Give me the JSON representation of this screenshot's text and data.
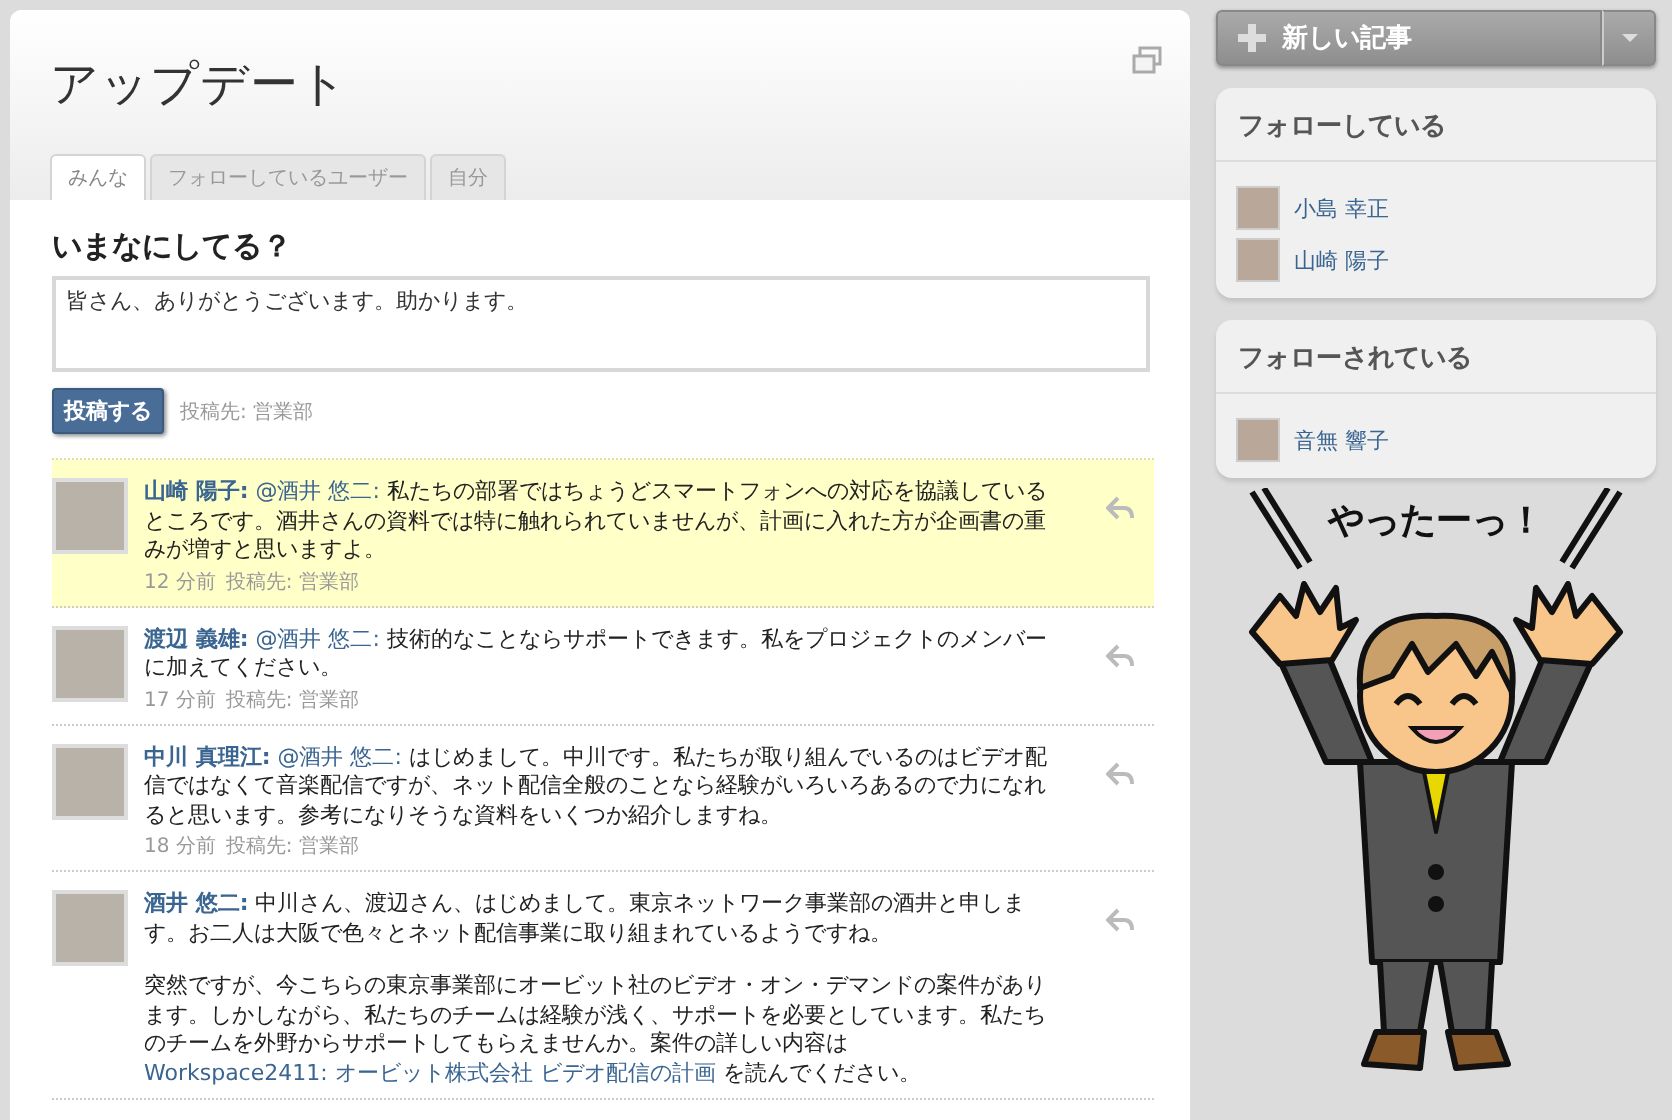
{
  "header": {
    "title": "アップデート"
  },
  "tabs": [
    {
      "label": "みんな",
      "selected": true
    },
    {
      "label": "フォローしているユーザー",
      "selected": false
    },
    {
      "label": "自分",
      "selected": false
    }
  ],
  "composer": {
    "heading": "いまなにしてる？",
    "value": "皆さん、ありがとうございます。助かります。",
    "button": "投稿する",
    "target": "投稿先: 営業部"
  },
  "posts": [
    {
      "author": "山崎 陽子:",
      "mention": "@酒井 悠二:",
      "highlighted": true,
      "paragraphs": [
        [
          {
            "kind": "text",
            "text": "私たちの部署ではちょうどスマートフォンへの対応を協議しているところです。酒井さんの資料では特に触れられていませんが、計画に入れた方が企画書の重みが増すと思いますよ。"
          }
        ]
      ],
      "time": "12 分前",
      "target": "投稿先: 営業部"
    },
    {
      "author": "渡辺 義雄:",
      "mention": "@酒井 悠二:",
      "highlighted": false,
      "paragraphs": [
        [
          {
            "kind": "text",
            "text": "技術的なことならサポートできます。私をプロジェクトのメンバーに加えてください。"
          }
        ]
      ],
      "time": "17 分前",
      "target": "投稿先: 営業部"
    },
    {
      "author": "中川 真理江:",
      "mention": "@酒井 悠二:",
      "highlighted": false,
      "paragraphs": [
        [
          {
            "kind": "text",
            "text": "はじめまして。中川です。私たちが取り組んでいるのはビデオ配信ではなくて音楽配信ですが、ネット配信全般のことなら経験がいろいろあるので力になれると思います。参考になりそうな資料をいくつか紹介しますね。"
          }
        ]
      ],
      "time": "18 分前",
      "target": "投稿先: 営業部"
    },
    {
      "author": "酒井 悠二:",
      "highlighted": false,
      "paragraphs": [
        [
          {
            "kind": "text",
            "text": "中川さん、渡辺さん、はじめまして。東京ネットワーク事業部の酒井と申します。お二人は大阪で色々とネット配信事業に取り組まれているようですね。"
          }
        ],
        [
          {
            "kind": "text",
            "text": "突然ですが、今こちらの東京事業部にオービット社のビデオ・オン・デマンドの案件があります。しかしながら、私たちのチームは経験が浅く、サポートを必要としています。私たちのチームを外野からサポートしてもらえませんか。案件の詳しい内容は"
          },
          {
            "kind": "link",
            "text": "Workspace2411: オービット株式会社 ビデオ配信の計画"
          },
          {
            "kind": "text",
            "text": " を読んでください。"
          }
        ]
      ]
    }
  ],
  "sidebar": {
    "new_button": "新しい記事",
    "panels": [
      {
        "title": "フォローしている",
        "users": [
          "小島 幸正",
          "山崎 陽子"
        ]
      },
      {
        "title": "フォローされている",
        "users": [
          "音無 響子"
        ]
      }
    ],
    "illustration": {
      "caption": "やったーっ！"
    }
  }
}
